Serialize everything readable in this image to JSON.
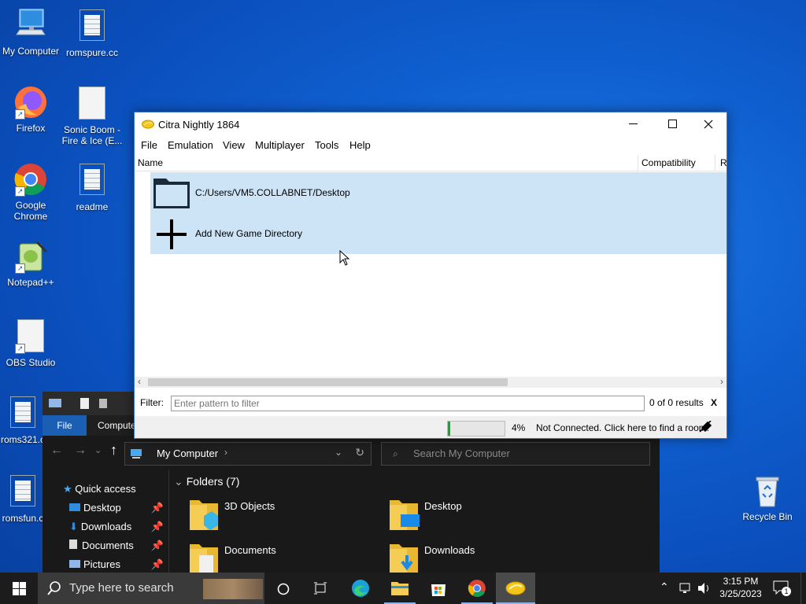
{
  "desktop": {
    "icons": [
      {
        "label": "My Computer"
      },
      {
        "label": "romspure.cc"
      },
      {
        "label": "Firefox"
      },
      {
        "label": "Sonic Boom - Fire & Ice (E..."
      },
      {
        "label": "Google Chrome"
      },
      {
        "label": "readme"
      },
      {
        "label": "Notepad++"
      },
      {
        "label": "OBS Studio"
      },
      {
        "label": "roms321.c"
      },
      {
        "label": "romsfun.c"
      },
      {
        "label": "Recycle Bin"
      }
    ]
  },
  "explorer": {
    "ribbon_file": "File",
    "ribbon_computer": "Compute",
    "address": "My Computer",
    "search_placeholder": "Search My Computer",
    "quick_access": "Quick access",
    "nav_items": [
      "Desktop",
      "Downloads",
      "Documents",
      "Pictures"
    ],
    "folders_header": "Folders (7)",
    "folders": [
      "3D Objects",
      "Desktop",
      "Documents",
      "Downloads"
    ]
  },
  "citra": {
    "title": "Citra Nightly 1864",
    "menu": [
      "File",
      "Emulation",
      "View",
      "Multiplayer",
      "Tools",
      "Help"
    ],
    "columns": {
      "name": "Name",
      "compatibility": "Compatibility",
      "region": "R"
    },
    "rows": [
      {
        "label": "C:/Users/VM5.COLLABNET/Desktop"
      },
      {
        "label": "Add New Game Directory"
      }
    ],
    "filter_label": "Filter:",
    "filter_placeholder": "Enter pattern to filter",
    "results": "0 of 0 results",
    "clear": "X",
    "progress_percent": "4%",
    "progress_value": 0.04,
    "room_status": "Not Connected. Click here to find a room!"
  },
  "taskbar": {
    "search_placeholder": "Type here to search",
    "time": "3:15 PM",
    "date": "3/25/2023",
    "notification_count": "1"
  },
  "colors": {
    "accent": "#1a5fb4",
    "selection": "#cde3f6",
    "progress": "#06b025"
  }
}
